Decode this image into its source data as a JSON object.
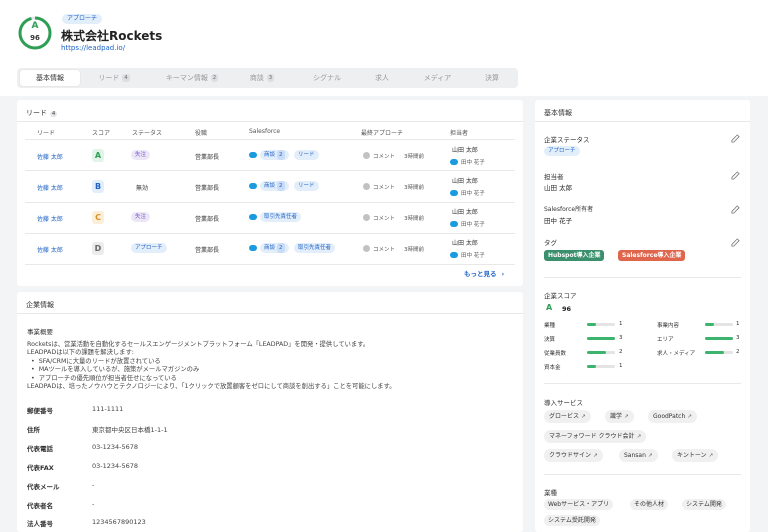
{
  "header": {
    "grade": "A",
    "score": "96",
    "phase": "アプローチ",
    "company_name": "株式会社Rockets",
    "url": "https://leadpad.io/"
  },
  "tabs": [
    {
      "label": "基本情報",
      "count": ""
    },
    {
      "label": "リード",
      "count": "4"
    },
    {
      "label": "キーマン情報",
      "count": "2"
    },
    {
      "label": "商談",
      "count": "3"
    },
    {
      "label": "シグナル",
      "count": ""
    },
    {
      "label": "求人",
      "count": ""
    },
    {
      "label": "メディア",
      "count": ""
    },
    {
      "label": "決算",
      "count": ""
    }
  ],
  "leads": {
    "title": "リード",
    "count": "4",
    "columns": [
      "リード",
      "スコア",
      "ステータス",
      "役職",
      "Salesforce",
      "最終アプローチ",
      "担当者"
    ],
    "rows": [
      {
        "name": "佐藤 太郎",
        "grade": "A",
        "status": "失注",
        "role": "営業部長",
        "sf1": "商談",
        "sf1_num": "2",
        "sf2": "リード",
        "approach": "コメント",
        "time": "3時間前",
        "owner1": "山田 太郎",
        "owner2": "田中 花子"
      },
      {
        "name": "佐藤 太郎",
        "grade": "B",
        "status": "無効",
        "role": "営業部長",
        "sf1": "商談",
        "sf1_num": "2",
        "sf2": "リード",
        "approach": "コメント",
        "time": "3時間前",
        "owner1": "山田 太郎",
        "owner2": "田中 花子"
      },
      {
        "name": "佐藤 太郎",
        "grade": "C",
        "status": "失注",
        "role": "営業部長",
        "sf1": "取引先責任者",
        "sf1_num": "",
        "sf2": "",
        "approach": "コメント",
        "time": "3時間前",
        "owner1": "山田 太郎",
        "owner2": "田中 花子"
      },
      {
        "name": "佐藤 太郎",
        "grade": "D",
        "status": "アプローチ",
        "role": "営業部長",
        "sf1": "商談",
        "sf1_num": "2",
        "sf2": "取引先責任者",
        "approach": "コメント",
        "time": "3時間前",
        "owner1": "山田 太郎",
        "owner2": "田中 花子"
      }
    ],
    "more": "もっと見る"
  },
  "company": {
    "title": "企業情報",
    "summary_label": "事業概要",
    "summary_lines": [
      "Rocketsは、営業活動を自動化するセールスエンゲージメントプラットフォーム「LEADPAD」を開発・提供しています。",
      "LEADPADは以下の課題を解決します:",
      "  •  SFA/CRMに大量のリードが放置されている",
      "  •  MAツールを導入しているが、施策がメールマガジンのみ",
      "  •  アプローチの優先順位が担当者任せになっている",
      "LEADPADは、培ったノウハウとテクノロジーにより、「1クリックで放置顧客をゼロにして商談を創出する」ことを可能にします。"
    ],
    "fields": [
      {
        "label": "郵便番号",
        "value": "111-1111"
      },
      {
        "label": "住所",
        "value": "東京都中央区日本橋1-1-1"
      },
      {
        "label": "代表電話",
        "value": "03-1234-5678"
      },
      {
        "label": "代表FAX",
        "value": "03-1234-5678"
      },
      {
        "label": "代表メール",
        "value": "-"
      },
      {
        "label": "代表者名",
        "value": "-"
      },
      {
        "label": "法人番号",
        "value": "1234567890123"
      }
    ]
  },
  "sidebar": {
    "title": "基本情報",
    "status_label": "企業ステータス",
    "status_value": "アプローチ",
    "owner_label": "担当者",
    "owner_value": "山田 太郎",
    "sf_owner_label": "Salesforce所有者",
    "sf_owner_value": "田中 花子",
    "tags_label": "タグ",
    "tags": [
      {
        "label": "Hubspot導入企業",
        "color": "#3a8f6c"
      },
      {
        "label": "Salesforce導入企業",
        "color": "#e0654d"
      }
    ],
    "score_label": "企業スコア",
    "score_grade": "A",
    "score_value": "96",
    "metrics_left": [
      {
        "label": "業種",
        "value": 1
      },
      {
        "label": "決算",
        "value": 3
      },
      {
        "label": "従業員数",
        "value": 2
      },
      {
        "label": "資本金",
        "value": 1
      }
    ],
    "metrics_right": [
      {
        "label": "事業内容",
        "value": 1
      },
      {
        "label": "エリア",
        "value": 3
      },
      {
        "label": "求人・メディア",
        "value": 2
      }
    ],
    "services_label": "導入サービス",
    "services": [
      "グロービス",
      "識学",
      "GoodPatch",
      "マネーフォワード クラウド会計",
      "クラウドサイン",
      "Sansan",
      "キントーン"
    ],
    "industry_label": "業種",
    "industries": [
      "Webサービス・アプリ",
      "その他人材",
      "システム開発",
      "システム受託開発"
    ]
  }
}
